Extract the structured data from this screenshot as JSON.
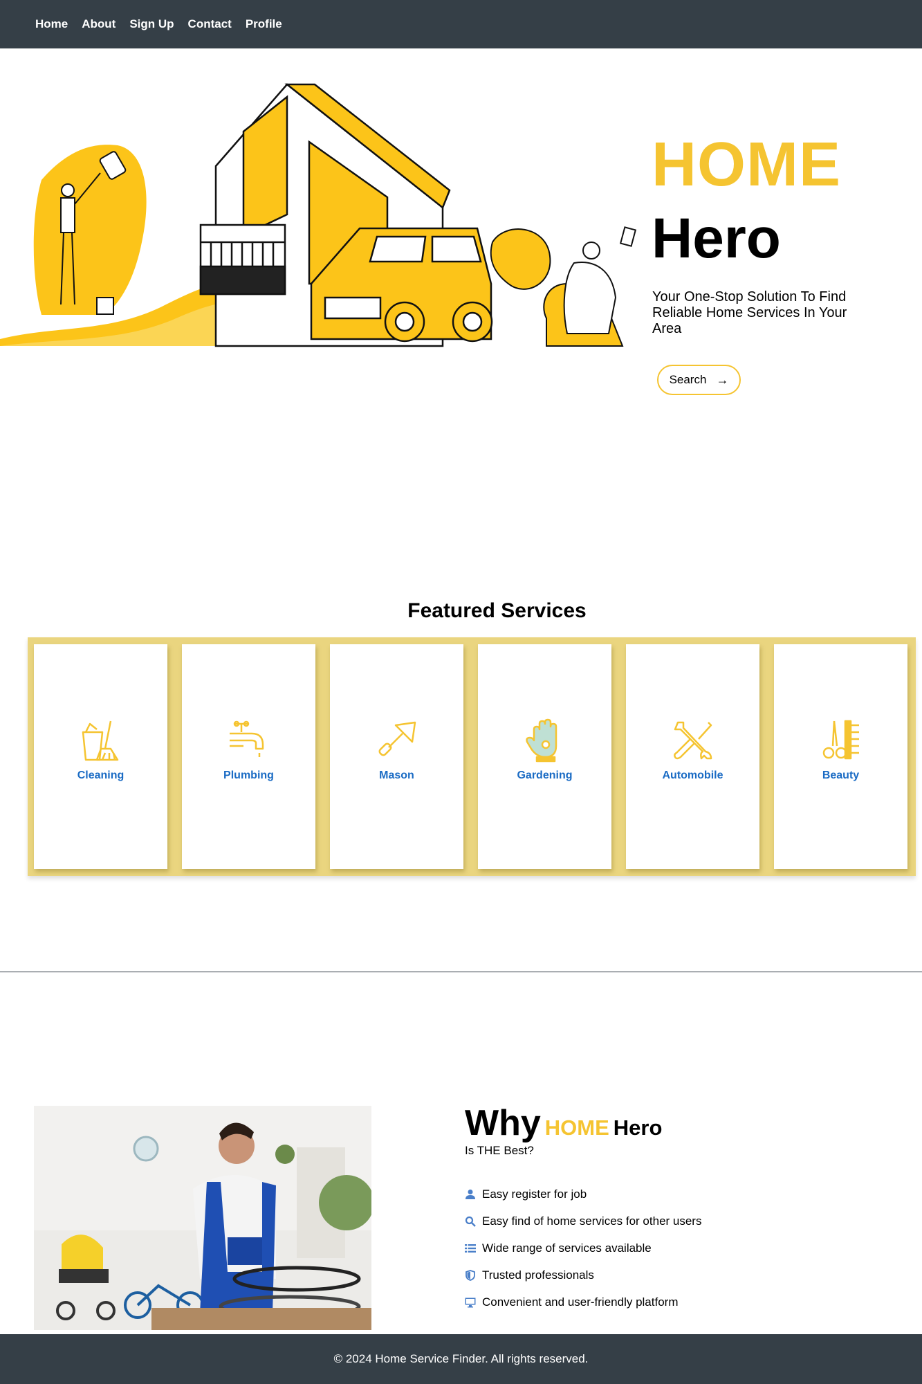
{
  "nav": {
    "items": [
      {
        "label": "Home"
      },
      {
        "label": "About"
      },
      {
        "label": "Sign Up"
      },
      {
        "label": "Contact"
      },
      {
        "label": "Profile"
      }
    ]
  },
  "hero": {
    "title_line1": "HOME",
    "title_line2": "Hero",
    "subtitle": "Your One-Stop Solution To Find Reliable Home Services In Your Area",
    "search_label": "Search",
    "search_arrow": "→"
  },
  "featured": {
    "title": "Featured Services",
    "services": [
      {
        "label": "Cleaning",
        "icon": "bucket-broom-icon"
      },
      {
        "label": "Plumbing",
        "icon": "faucet-icon"
      },
      {
        "label": "Mason",
        "icon": "trowel-icon"
      },
      {
        "label": "Gardening",
        "icon": "glove-flower-icon"
      },
      {
        "label": "Automobile",
        "icon": "wrench-screwdriver-icon"
      },
      {
        "label": "Beauty",
        "icon": "scissors-comb-icon"
      }
    ]
  },
  "why": {
    "word": "Why",
    "brand_home": "HOME",
    "brand_hero": "Hero",
    "subtitle": "Is THE Best?",
    "items": [
      {
        "label": "Easy register for job",
        "icon": "user-icon"
      },
      {
        "label": "Easy find of home services for other users",
        "icon": "search-icon"
      },
      {
        "label": "Wide range of services available",
        "icon": "list-icon"
      },
      {
        "label": "Trusted professionals",
        "icon": "shield-icon"
      },
      {
        "label": "Convenient and user-friendly platform",
        "icon": "monitor-icon"
      }
    ]
  },
  "footer": {
    "text": "© 2024 Home Service Finder. All rights reserved."
  },
  "colors": {
    "navbar": "#353f47",
    "accent_yellow": "#f5c431",
    "services_frame": "#ead57f",
    "service_label": "#1a6bc4",
    "icon_blue": "#4a7fc9"
  }
}
